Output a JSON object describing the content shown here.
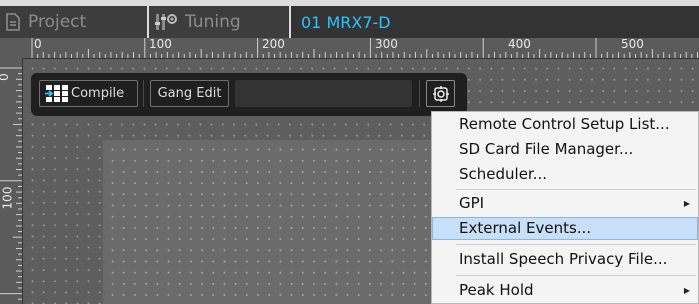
{
  "tabs": [
    {
      "label": "Project",
      "icon": "document-icon",
      "active": false
    },
    {
      "label": "Tuning",
      "icon": "tuning-sliders-icon",
      "active": false
    },
    {
      "label": "01 MRX7-D",
      "active": true
    }
  ],
  "ruler": {
    "horizontal": [
      "0",
      "100",
      "200",
      "300",
      "400",
      "500"
    ],
    "vertical": [
      "0",
      "100"
    ]
  },
  "toolbar": {
    "compile_label": "Compile",
    "gang_edit_label": "Gang Edit",
    "settings_icon": "settings-icon"
  },
  "menu": {
    "items": [
      {
        "label": "Remote Control Setup List...",
        "submenu": false
      },
      {
        "label": "SD Card File Manager...",
        "submenu": false
      },
      {
        "label": "Scheduler...",
        "submenu": false
      },
      {
        "label": "GPI",
        "submenu": true
      },
      {
        "label": "External Events...",
        "submenu": false,
        "highlighted": true
      },
      {
        "label": "Install Speech Privacy File...",
        "submenu": false
      },
      {
        "label": "Peak Hold",
        "submenu": true
      }
    ]
  },
  "colors": {
    "active_tab_text": "#2bc3ff",
    "menu_highlight": "#c7e0f7"
  }
}
